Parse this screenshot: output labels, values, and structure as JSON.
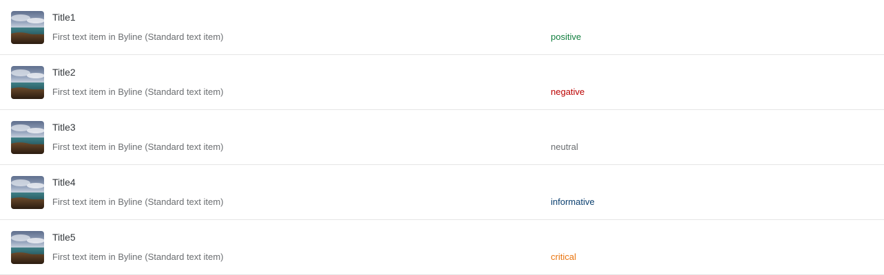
{
  "items": [
    {
      "title": "Title1",
      "byline": "First text item in Byline (Standard text item)",
      "status": "positive"
    },
    {
      "title": "Title2",
      "byline": "First text item in Byline (Standard text item)",
      "status": "negative"
    },
    {
      "title": "Title3",
      "byline": "First text item in Byline (Standard text item)",
      "status": "neutral"
    },
    {
      "title": "Title4",
      "byline": "First text item in Byline (Standard text item)",
      "status": "informative"
    },
    {
      "title": "Title5",
      "byline": "First text item in Byline (Standard text item)",
      "status": "critical"
    }
  ],
  "status_colors": {
    "positive": "#107e3e",
    "negative": "#bb0000",
    "neutral": "#6a6d70",
    "informative": "#0a3f6f",
    "critical": "#e9730c"
  },
  "thumbnail_icon": "landscape-photo-icon"
}
